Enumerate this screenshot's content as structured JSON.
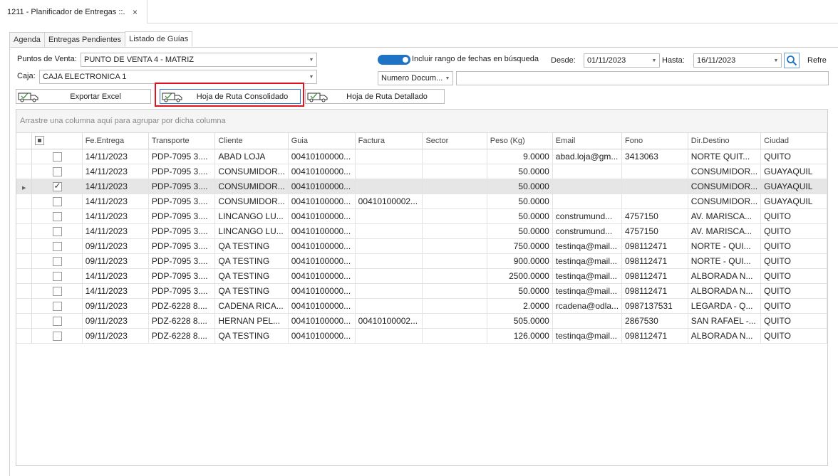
{
  "window": {
    "doc_tab_title": "1211 - Planificador de Entregas ::.",
    "close_glyph": "×"
  },
  "tabs": [
    {
      "label": "Agenda",
      "active": false
    },
    {
      "label": "Entregas Pendientes",
      "active": false
    },
    {
      "label": "Listado de Guías",
      "active": true
    }
  ],
  "filters": {
    "puntos_label": "Puntos de Venta:",
    "puntos_value": "PUNTO DE VENTA 4 - MATRIZ",
    "caja_label": "Caja:",
    "caja_value": "CAJA ELECTRONICA 1",
    "toggle_label": "Incluir rango de fechas en búsqueda",
    "toggle_on": true,
    "desde_label": "Desde:",
    "desde_value": "01/11/2023",
    "hasta_label": "Hasta:",
    "hasta_value": "16/11/2023",
    "refresh_label": "Refre",
    "doc_type_value": "Numero Docum...",
    "doc_search_value": ""
  },
  "buttons": {
    "export_excel": "Exportar Excel",
    "hoja_consolidado": "Hoja de Ruta Consolidado",
    "hoja_detallado": "Hoja de Ruta Detallado"
  },
  "grid": {
    "group_hint": "Arrastre una columna aquí para agrupar por dicha columna",
    "columns": [
      "Fe.Entrega",
      "Transporte",
      "Cliente",
      "Guia",
      "Factura",
      "Sector",
      "Peso (Kg)",
      "Email",
      "Fono",
      "Dir.Destino",
      "Ciudad"
    ],
    "rows": [
      {
        "checked": false,
        "selected": false,
        "cells": [
          "14/11/2023",
          "PDP-7095  3....",
          "ABAD LOJA",
          "00410100000...",
          "",
          "",
          "9.0000",
          "abad.loja@gm...",
          "3413063",
          "NORTE QUIT...",
          "QUITO"
        ]
      },
      {
        "checked": false,
        "selected": false,
        "cells": [
          "14/11/2023",
          "PDP-7095  3....",
          "CONSUMIDOR...",
          "00410100000...",
          "",
          "",
          "50.0000",
          "",
          "",
          "CONSUMIDOR...",
          "GUAYAQUIL"
        ]
      },
      {
        "checked": true,
        "selected": true,
        "cells": [
          "14/11/2023",
          "PDP-7095  3....",
          "CONSUMIDOR...",
          "00410100000...",
          "",
          "",
          "50.0000",
          "",
          "",
          "CONSUMIDOR...",
          "GUAYAQUIL"
        ]
      },
      {
        "checked": false,
        "selected": false,
        "cells": [
          "14/11/2023",
          "PDP-7095  3....",
          "CONSUMIDOR...",
          "00410100000...",
          "00410100002...",
          "",
          "50.0000",
          "",
          "",
          "CONSUMIDOR...",
          "GUAYAQUIL"
        ]
      },
      {
        "checked": false,
        "selected": false,
        "cells": [
          "14/11/2023",
          "PDP-7095  3....",
          "LINCANGO LU...",
          "00410100000...",
          "",
          "",
          "50.0000",
          "construmund...",
          "4757150",
          "AV. MARISCA...",
          "QUITO"
        ]
      },
      {
        "checked": false,
        "selected": false,
        "cells": [
          "14/11/2023",
          "PDP-7095  3....",
          "LINCANGO LU...",
          "00410100000...",
          "",
          "",
          "50.0000",
          "construmund...",
          "4757150",
          "AV. MARISCA...",
          "QUITO"
        ]
      },
      {
        "checked": false,
        "selected": false,
        "cells": [
          "09/11/2023",
          "PDP-7095  3....",
          "QA TESTING",
          "00410100000...",
          "",
          "",
          "750.0000",
          "testinqa@mail...",
          "098112471",
          "NORTE - QUI...",
          "QUITO"
        ]
      },
      {
        "checked": false,
        "selected": false,
        "cells": [
          "09/11/2023",
          "PDP-7095  3....",
          "QA TESTING",
          "00410100000...",
          "",
          "",
          "900.0000",
          "testinqa@mail...",
          "098112471",
          "NORTE - QUI...",
          "QUITO"
        ]
      },
      {
        "checked": false,
        "selected": false,
        "cells": [
          "14/11/2023",
          "PDP-7095  3....",
          "QA TESTING",
          "00410100000...",
          "",
          "",
          "2500.0000",
          "testinqa@mail...",
          "098112471",
          "ALBORADA N...",
          "QUITO"
        ]
      },
      {
        "checked": false,
        "selected": false,
        "cells": [
          "14/11/2023",
          "PDP-7095  3....",
          "QA TESTING",
          "00410100000...",
          "",
          "",
          "50.0000",
          "testinqa@mail...",
          "098112471",
          "ALBORADA N...",
          "QUITO"
        ]
      },
      {
        "checked": false,
        "selected": false,
        "cells": [
          "09/11/2023",
          "PDZ-6228  8....",
          "CADENA RICA...",
          "00410100000...",
          "",
          "",
          "2.0000",
          "rcadena@odla...",
          "0987137531",
          "LEGARDA - Q...",
          "QUITO"
        ]
      },
      {
        "checked": false,
        "selected": false,
        "cells": [
          "09/11/2023",
          "PDZ-6228  8....",
          "HERNAN PEL...",
          "00410100000...",
          "00410100002...",
          "",
          "505.0000",
          "",
          "2867530",
          "SAN RAFAEL -...",
          "QUITO"
        ]
      },
      {
        "checked": false,
        "selected": false,
        "cells": [
          "09/11/2023",
          "PDZ-6228  8....",
          "QA TESTING",
          "00410100000...",
          "",
          "",
          "126.0000",
          "testinqa@mail...",
          "098112471",
          "ALBORADA N...",
          "QUITO"
        ]
      }
    ]
  },
  "colors": {
    "accent": "#1f73c7",
    "highlight": "#e0141e",
    "selected_row": "#e6e6e6"
  }
}
